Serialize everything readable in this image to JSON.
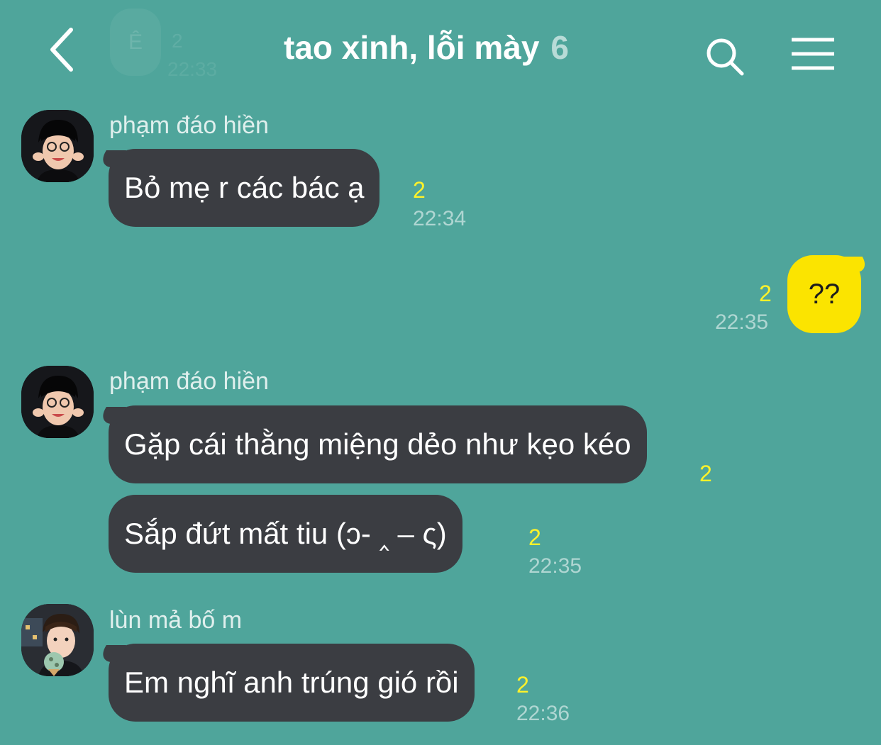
{
  "header": {
    "back_label": "<",
    "ghost_avatar_letter": "Ê",
    "ghost_count": "2",
    "ghost_time": "22:33",
    "title": "tao xinh, lỗi mày",
    "member_count": "6"
  },
  "messages": [
    {
      "sender": "phạm đáo hiền",
      "text": "Bỏ mẹ r các bác ạ",
      "unread": "2",
      "time": "22:34"
    },
    {
      "sender": "me",
      "text": "??",
      "unread": "2",
      "time": "22:35"
    },
    {
      "sender": "phạm đáo hiền",
      "text": "Gặp cái thằng miệng dẻo như kẹo kéo",
      "unread": "2"
    },
    {
      "sender": "phạm đáo hiền",
      "text": "Sắp đứt mất tiu (ↄ- ‸ – ς)",
      "unread": "2",
      "time": "22:35"
    },
    {
      "sender": "lùn mả bố m",
      "text": "Em nghĩ anh trúng gió rồi",
      "unread": "2",
      "time": "22:36"
    }
  ],
  "colors": {
    "background": "#4fa59b",
    "incoming_bubble": "#3b3d42",
    "outgoing_bubble": "#fbe400",
    "unread_count": "#fff22a"
  },
  "icons": [
    "chevron-left-icon",
    "search-icon",
    "hamburger-menu-icon"
  ]
}
